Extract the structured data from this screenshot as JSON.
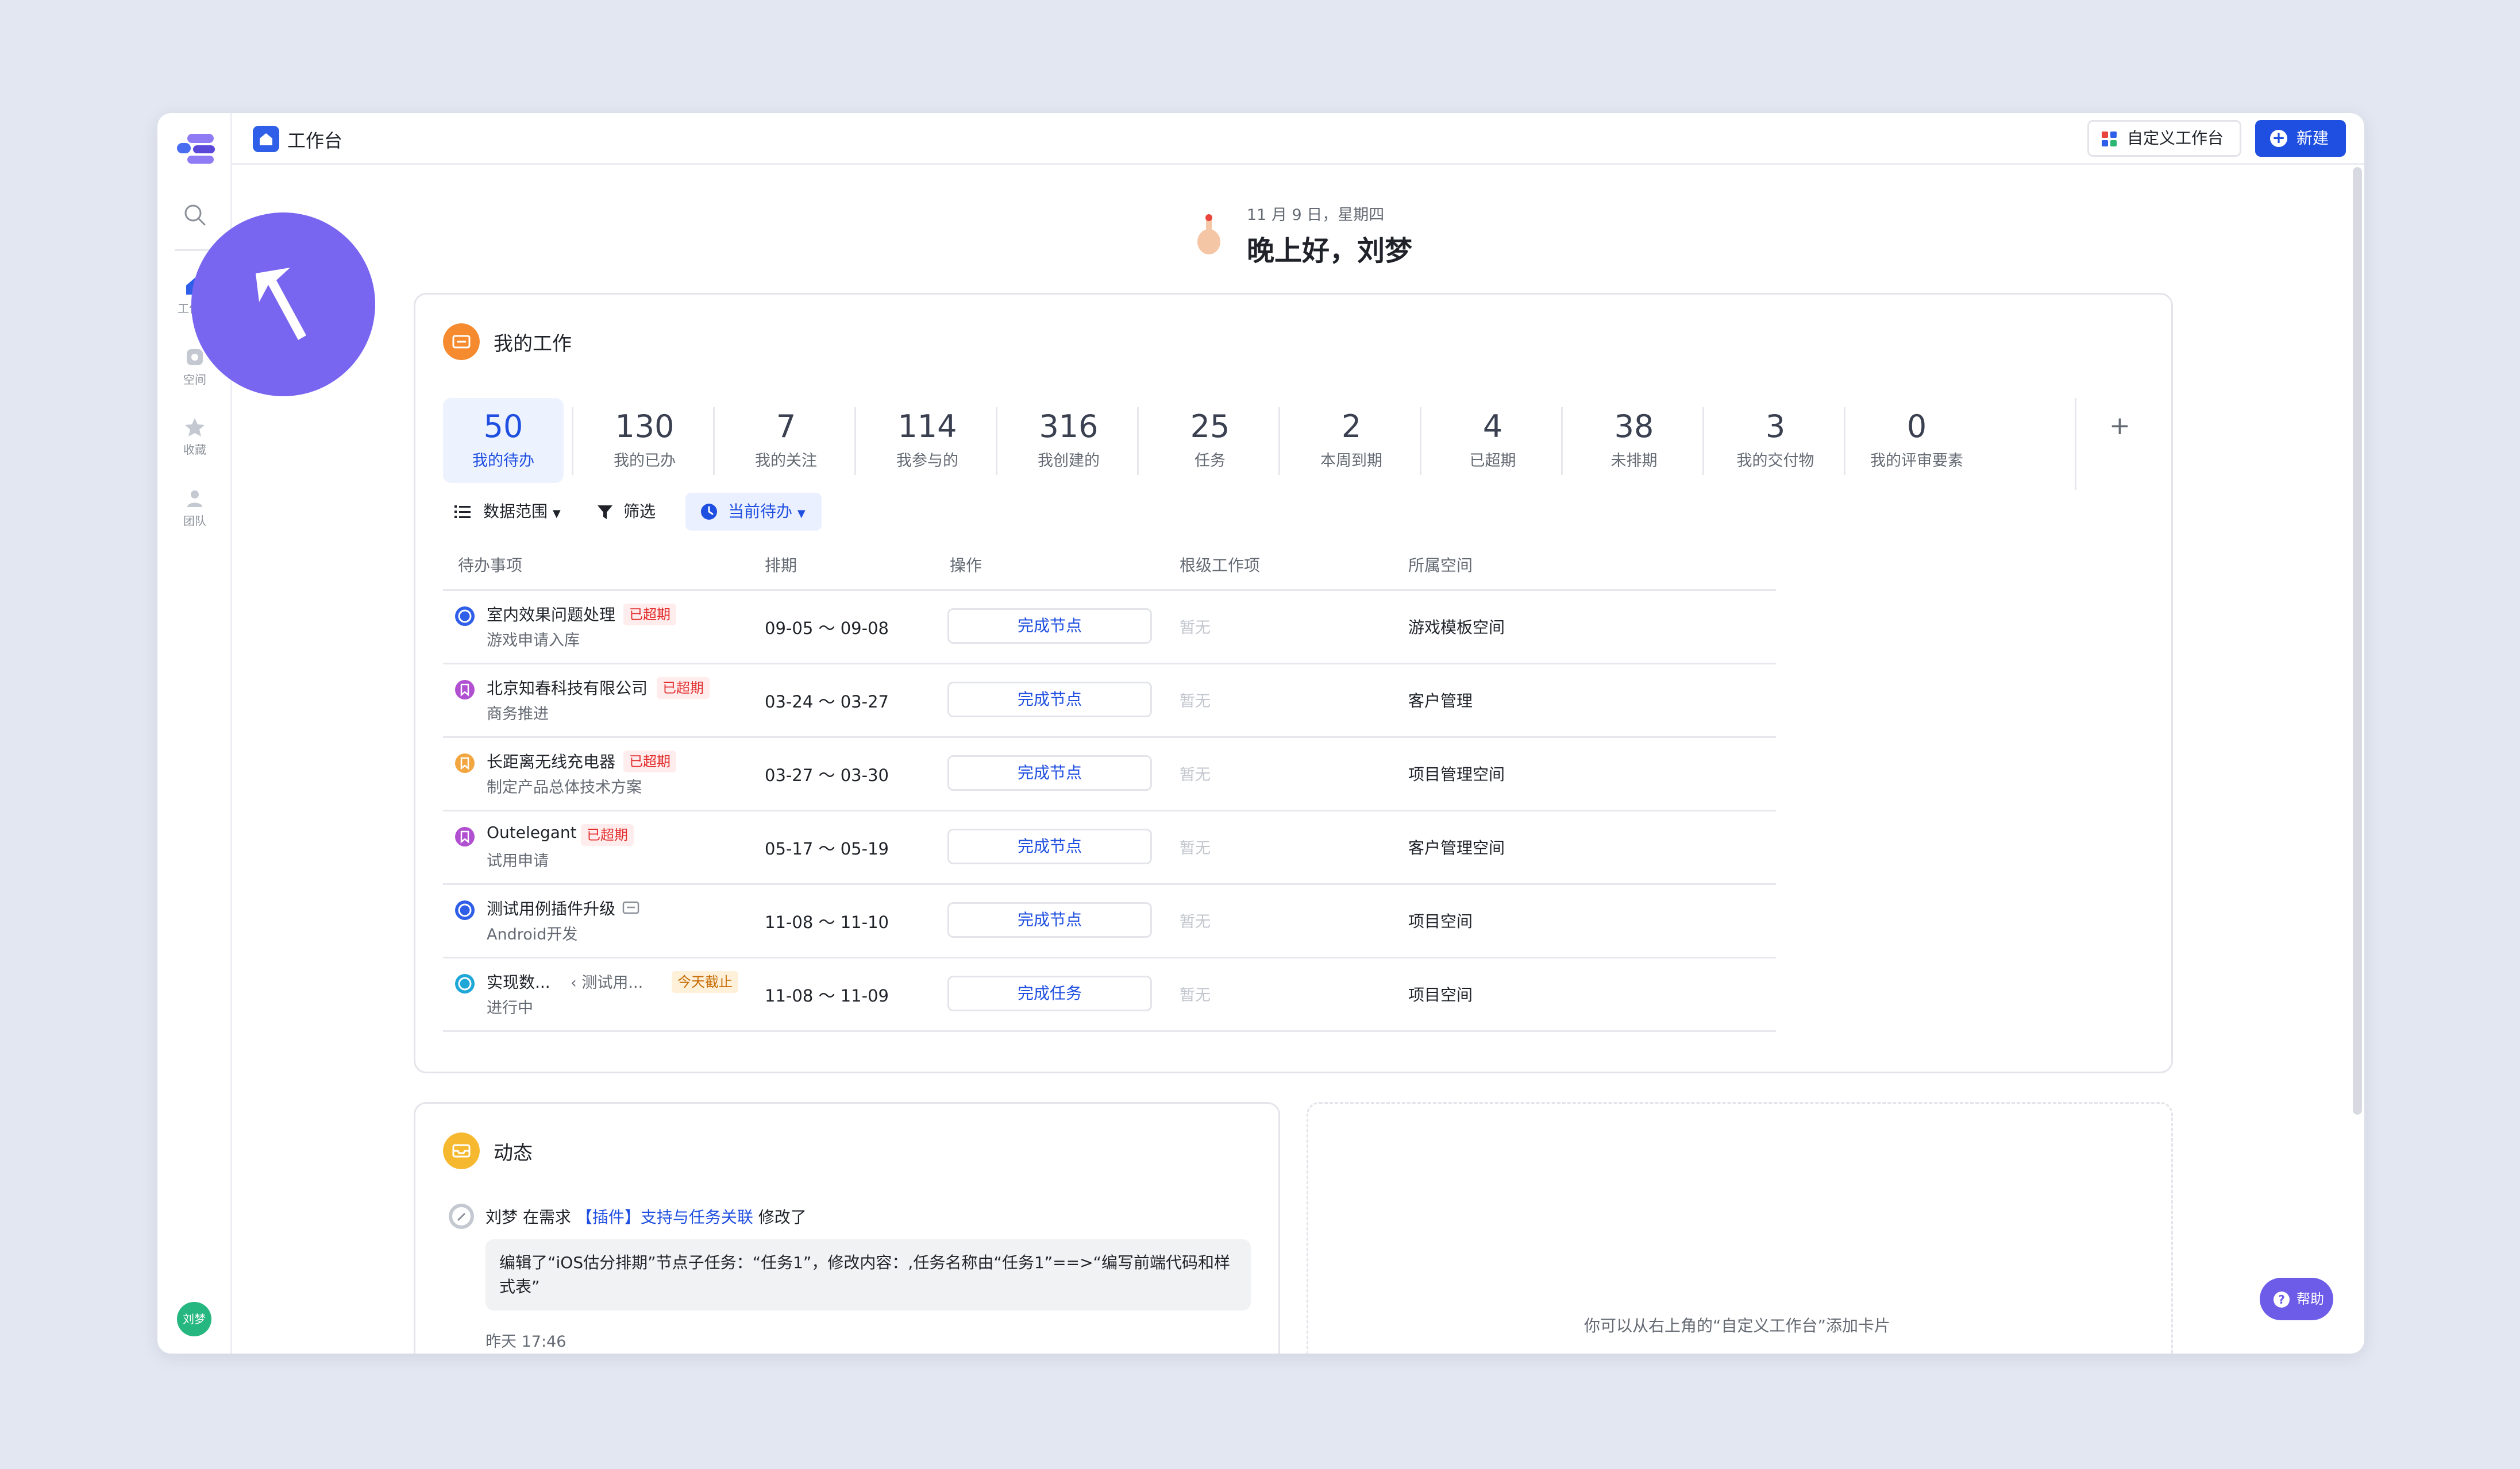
{
  "sidebar": {
    "items": [
      {
        "label": "工作台",
        "icon": "home-icon"
      },
      {
        "label": "空间",
        "icon": "space-icon"
      },
      {
        "label": "收藏",
        "icon": "star-icon"
      },
      {
        "label": "团队",
        "icon": "team-icon"
      }
    ],
    "avatar": "刘梦"
  },
  "topbar": {
    "title": "工作台",
    "custom_label": "自定义工作台",
    "new_label": "新建"
  },
  "greeting": {
    "date": "11 月 9 日，星期四",
    "text": "晚上好，刘梦"
  },
  "my_work": {
    "title": "我的工作",
    "stats": [
      {
        "num": "50",
        "label": "我的待办"
      },
      {
        "num": "130",
        "label": "我的已办"
      },
      {
        "num": "7",
        "label": "我的关注"
      },
      {
        "num": "114",
        "label": "我参与的"
      },
      {
        "num": "316",
        "label": "我创建的"
      },
      {
        "num": "25",
        "label": "任务"
      },
      {
        "num": "2",
        "label": "本周到期"
      },
      {
        "num": "4",
        "label": "已超期"
      },
      {
        "num": "38",
        "label": "未排期"
      },
      {
        "num": "3",
        "label": "我的交付物"
      },
      {
        "num": "0",
        "label": "我的评审要素"
      }
    ],
    "add_label": "+",
    "filters": {
      "scope": "数据范围",
      "filter": "筛选",
      "current": "当前待办"
    },
    "columns": [
      "待办事项",
      "排期",
      "操作",
      "根级工作项",
      "所属空间"
    ],
    "rows": [
      {
        "title": "室内效果问题处理",
        "tag": "已超期",
        "sub": "游戏申请入库",
        "date": "09-05 ～ 09-08",
        "action": "完成节点",
        "root": "暂无",
        "space": "游戏模板空间",
        "color": "#2f5ee8"
      },
      {
        "title": "北京知春科技有限公司",
        "tag": "已超期",
        "sub": "商务推进",
        "date": "03-24 ～ 03-27",
        "action": "完成节点",
        "root": "暂无",
        "space": "客户管理",
        "color": "#b04fd0"
      },
      {
        "title": "长距离无线充电器",
        "tag": "已超期",
        "sub": "制定产品总体技术方案",
        "date": "03-27 ～ 03-30",
        "action": "完成节点",
        "root": "暂无",
        "space": "项目管理空间",
        "color": "#f2a640"
      },
      {
        "title": "Outelegant",
        "tag": "已超期",
        "sub": "试用申请",
        "date": "05-17 ～ 05-19",
        "action": "完成节点",
        "root": "暂无",
        "space": "客户管理空间",
        "color": "#b04fd0"
      },
      {
        "title": "测试用例插件升级",
        "tag": "",
        "sub": "Android开发",
        "date": "11-08 ～ 11-10",
        "action": "完成节点",
        "root": "暂无",
        "space": "项目空间",
        "color": "#2f5ee8"
      },
      {
        "title": "实现数...",
        "parent": "测试用...",
        "tag": "今天截止",
        "sub": "进行中",
        "date": "11-08 ～ 11-09",
        "action": "完成任务",
        "root": "暂无",
        "space": "项目空间",
        "color": "#1fa7d8"
      }
    ]
  },
  "activity": {
    "title": "动态",
    "user": "刘梦",
    "verb": "在需求",
    "link": "【插件】支持与任务关联",
    "suffix": "修改了",
    "detail": "编辑了“iOS估分排期”节点子任务：“任务1”，修改内容：,任务名称由“任务1”==>“编写前端代码和样式表”",
    "time": "昨天 17:46"
  },
  "empty_card": {
    "tip": "你可以从右上角的“自定义工作台”添加卡片"
  },
  "help_label": "帮助"
}
